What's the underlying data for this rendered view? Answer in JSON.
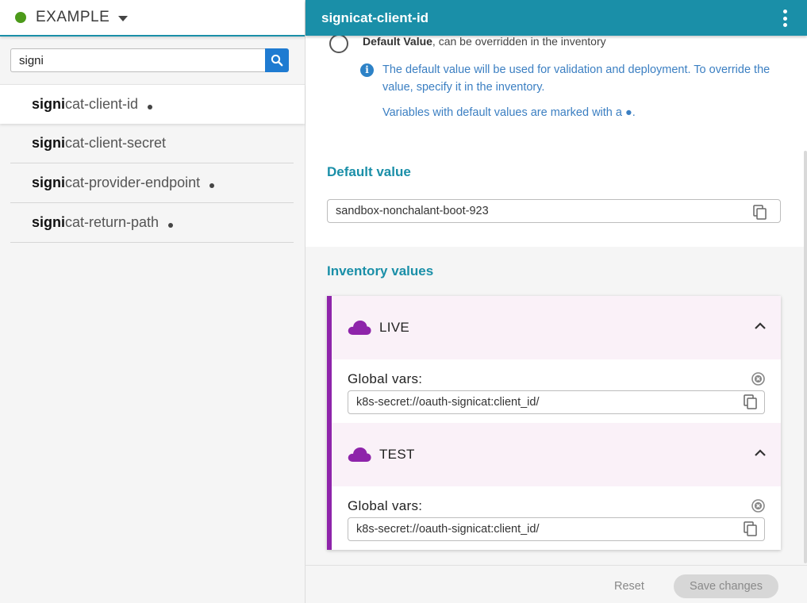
{
  "environment": {
    "name": "EXAMPLE",
    "status_color": "#4c9a1a"
  },
  "search": {
    "value": "signi",
    "placeholder": ""
  },
  "variables": [
    {
      "match": "signi",
      "rest": "cat-client-id",
      "has_default": true,
      "active": true
    },
    {
      "match": "signi",
      "rest": "cat-client-secret",
      "has_default": false,
      "active": false
    },
    {
      "match": "signi",
      "rest": "cat-provider-endpoint",
      "has_default": true,
      "active": false
    },
    {
      "match": "signi",
      "rest": "cat-return-path",
      "has_default": true,
      "active": false
    }
  ],
  "main": {
    "title": "signicat-client-id",
    "radio": {
      "bold": "Default Value",
      "text": ", can be overridden in the inventory"
    },
    "info": {
      "line1": "The default value will be used for validation and deployment. To override the value, specify it in the inventory.",
      "line2": "Variables with default values are marked with a ●."
    },
    "default_value": {
      "heading": "Default value",
      "value": "sandbox-nonchalant-boot-923"
    },
    "inventory": {
      "heading": "Inventory values",
      "environments": [
        {
          "name": "LIVE",
          "global_label": "Global vars:",
          "value": "k8s-secret://oauth-signicat:client_id/"
        },
        {
          "name": "TEST",
          "global_label": "Global vars:",
          "value": "k8s-secret://oauth-signicat:client_id/"
        }
      ]
    },
    "footer": {
      "reset": "Reset",
      "save": "Save changes"
    }
  },
  "colors": {
    "accent": "#1a8fa8",
    "env_purple": "#8e24aa",
    "info_blue": "#3b7fc2",
    "search_button": "#1f7bd1"
  }
}
